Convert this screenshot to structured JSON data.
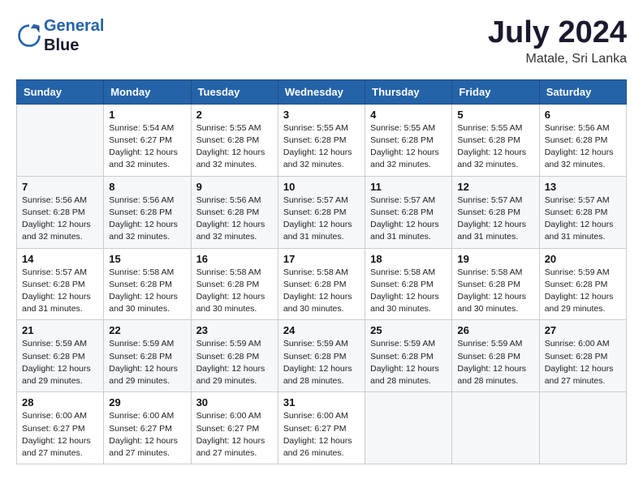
{
  "header": {
    "logo_line1": "General",
    "logo_line2": "Blue",
    "month_year": "July 2024",
    "location": "Matale, Sri Lanka"
  },
  "weekdays": [
    "Sunday",
    "Monday",
    "Tuesday",
    "Wednesday",
    "Thursday",
    "Friday",
    "Saturday"
  ],
  "weeks": [
    [
      {
        "day": "",
        "sunrise": "",
        "sunset": "",
        "daylight": ""
      },
      {
        "day": "1",
        "sunrise": "5:54 AM",
        "sunset": "6:27 PM",
        "daylight": "12 hours and 32 minutes."
      },
      {
        "day": "2",
        "sunrise": "5:55 AM",
        "sunset": "6:28 PM",
        "daylight": "12 hours and 32 minutes."
      },
      {
        "day": "3",
        "sunrise": "5:55 AM",
        "sunset": "6:28 PM",
        "daylight": "12 hours and 32 minutes."
      },
      {
        "day": "4",
        "sunrise": "5:55 AM",
        "sunset": "6:28 PM",
        "daylight": "12 hours and 32 minutes."
      },
      {
        "day": "5",
        "sunrise": "5:55 AM",
        "sunset": "6:28 PM",
        "daylight": "12 hours and 32 minutes."
      },
      {
        "day": "6",
        "sunrise": "5:56 AM",
        "sunset": "6:28 PM",
        "daylight": "12 hours and 32 minutes."
      }
    ],
    [
      {
        "day": "7",
        "sunrise": "5:56 AM",
        "sunset": "6:28 PM",
        "daylight": "12 hours and 32 minutes."
      },
      {
        "day": "8",
        "sunrise": "5:56 AM",
        "sunset": "6:28 PM",
        "daylight": "12 hours and 32 minutes."
      },
      {
        "day": "9",
        "sunrise": "5:56 AM",
        "sunset": "6:28 PM",
        "daylight": "12 hours and 32 minutes."
      },
      {
        "day": "10",
        "sunrise": "5:57 AM",
        "sunset": "6:28 PM",
        "daylight": "12 hours and 31 minutes."
      },
      {
        "day": "11",
        "sunrise": "5:57 AM",
        "sunset": "6:28 PM",
        "daylight": "12 hours and 31 minutes."
      },
      {
        "day": "12",
        "sunrise": "5:57 AM",
        "sunset": "6:28 PM",
        "daylight": "12 hours and 31 minutes."
      },
      {
        "day": "13",
        "sunrise": "5:57 AM",
        "sunset": "6:28 PM",
        "daylight": "12 hours and 31 minutes."
      }
    ],
    [
      {
        "day": "14",
        "sunrise": "5:57 AM",
        "sunset": "6:28 PM",
        "daylight": "12 hours and 31 minutes."
      },
      {
        "day": "15",
        "sunrise": "5:58 AM",
        "sunset": "6:28 PM",
        "daylight": "12 hours and 30 minutes."
      },
      {
        "day": "16",
        "sunrise": "5:58 AM",
        "sunset": "6:28 PM",
        "daylight": "12 hours and 30 minutes."
      },
      {
        "day": "17",
        "sunrise": "5:58 AM",
        "sunset": "6:28 PM",
        "daylight": "12 hours and 30 minutes."
      },
      {
        "day": "18",
        "sunrise": "5:58 AM",
        "sunset": "6:28 PM",
        "daylight": "12 hours and 30 minutes."
      },
      {
        "day": "19",
        "sunrise": "5:58 AM",
        "sunset": "6:28 PM",
        "daylight": "12 hours and 30 minutes."
      },
      {
        "day": "20",
        "sunrise": "5:59 AM",
        "sunset": "6:28 PM",
        "daylight": "12 hours and 29 minutes."
      }
    ],
    [
      {
        "day": "21",
        "sunrise": "5:59 AM",
        "sunset": "6:28 PM",
        "daylight": "12 hours and 29 minutes."
      },
      {
        "day": "22",
        "sunrise": "5:59 AM",
        "sunset": "6:28 PM",
        "daylight": "12 hours and 29 minutes."
      },
      {
        "day": "23",
        "sunrise": "5:59 AM",
        "sunset": "6:28 PM",
        "daylight": "12 hours and 29 minutes."
      },
      {
        "day": "24",
        "sunrise": "5:59 AM",
        "sunset": "6:28 PM",
        "daylight": "12 hours and 28 minutes."
      },
      {
        "day": "25",
        "sunrise": "5:59 AM",
        "sunset": "6:28 PM",
        "daylight": "12 hours and 28 minutes."
      },
      {
        "day": "26",
        "sunrise": "5:59 AM",
        "sunset": "6:28 PM",
        "daylight": "12 hours and 28 minutes."
      },
      {
        "day": "27",
        "sunrise": "6:00 AM",
        "sunset": "6:28 PM",
        "daylight": "12 hours and 27 minutes."
      }
    ],
    [
      {
        "day": "28",
        "sunrise": "6:00 AM",
        "sunset": "6:27 PM",
        "daylight": "12 hours and 27 minutes."
      },
      {
        "day": "29",
        "sunrise": "6:00 AM",
        "sunset": "6:27 PM",
        "daylight": "12 hours and 27 minutes."
      },
      {
        "day": "30",
        "sunrise": "6:00 AM",
        "sunset": "6:27 PM",
        "daylight": "12 hours and 27 minutes."
      },
      {
        "day": "31",
        "sunrise": "6:00 AM",
        "sunset": "6:27 PM",
        "daylight": "12 hours and 26 minutes."
      },
      {
        "day": "",
        "sunrise": "",
        "sunset": "",
        "daylight": ""
      },
      {
        "day": "",
        "sunrise": "",
        "sunset": "",
        "daylight": ""
      },
      {
        "day": "",
        "sunrise": "",
        "sunset": "",
        "daylight": ""
      }
    ]
  ],
  "labels": {
    "sunrise_prefix": "Sunrise: ",
    "sunset_prefix": "Sunset: ",
    "daylight_prefix": "Daylight: "
  }
}
